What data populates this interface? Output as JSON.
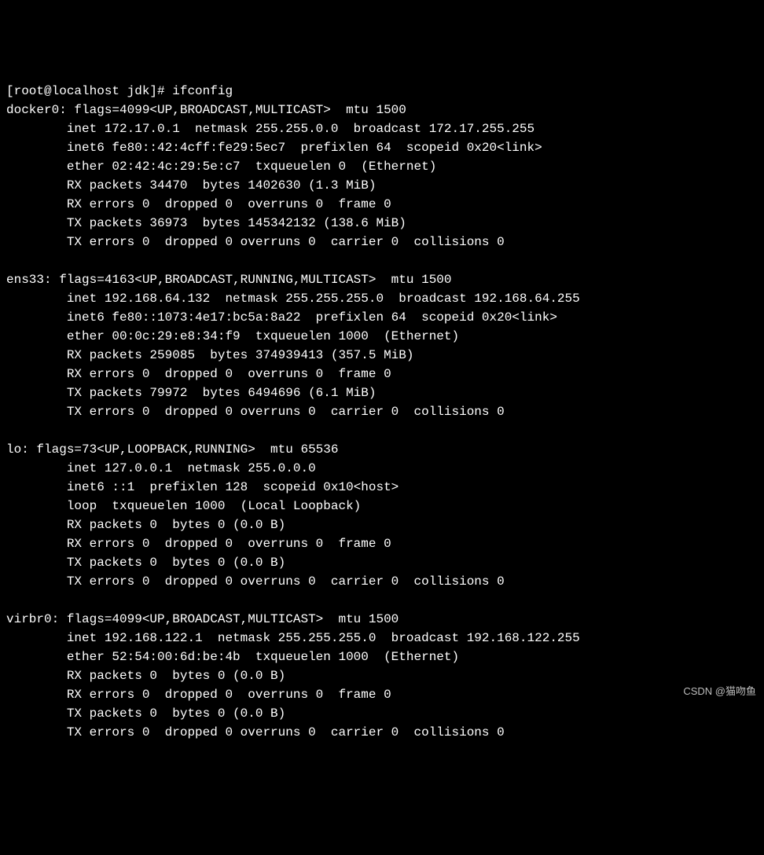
{
  "prompt": "[root@localhost jdk]# ifconfig",
  "interfaces": [
    {
      "name": "docker0",
      "header": "flags=4099<UP,BROADCAST,MULTICAST>  mtu 1500",
      "lines": [
        "inet 172.17.0.1  netmask 255.255.0.0  broadcast 172.17.255.255",
        "inet6 fe80::42:4cff:fe29:5ec7  prefixlen 64  scopeid 0x20<link>",
        "ether 02:42:4c:29:5e:c7  txqueuelen 0  (Ethernet)",
        "RX packets 34470  bytes 1402630 (1.3 MiB)",
        "RX errors 0  dropped 0  overruns 0  frame 0",
        "TX packets 36973  bytes 145342132 (138.6 MiB)",
        "TX errors 0  dropped 0 overruns 0  carrier 0  collisions 0"
      ]
    },
    {
      "name": "ens33",
      "header": "flags=4163<UP,BROADCAST,RUNNING,MULTICAST>  mtu 1500",
      "lines": [
        "inet 192.168.64.132  netmask 255.255.255.0  broadcast 192.168.64.255",
        "inet6 fe80::1073:4e17:bc5a:8a22  prefixlen 64  scopeid 0x20<link>",
        "ether 00:0c:29:e8:34:f9  txqueuelen 1000  (Ethernet)",
        "RX packets 259085  bytes 374939413 (357.5 MiB)",
        "RX errors 0  dropped 0  overruns 0  frame 0",
        "TX packets 79972  bytes 6494696 (6.1 MiB)",
        "TX errors 0  dropped 0 overruns 0  carrier 0  collisions 0"
      ]
    },
    {
      "name": "lo",
      "header": "flags=73<UP,LOOPBACK,RUNNING>  mtu 65536",
      "lines": [
        "inet 127.0.0.1  netmask 255.0.0.0",
        "inet6 ::1  prefixlen 128  scopeid 0x10<host>",
        "loop  txqueuelen 1000  (Local Loopback)",
        "RX packets 0  bytes 0 (0.0 B)",
        "RX errors 0  dropped 0  overruns 0  frame 0",
        "TX packets 0  bytes 0 (0.0 B)",
        "TX errors 0  dropped 0 overruns 0  carrier 0  collisions 0"
      ]
    },
    {
      "name": "virbr0",
      "header": "flags=4099<UP,BROADCAST,MULTICAST>  mtu 1500",
      "lines": [
        "inet 192.168.122.1  netmask 255.255.255.0  broadcast 192.168.122.255",
        "ether 52:54:00:6d:be:4b  txqueuelen 1000  (Ethernet)",
        "RX packets 0  bytes 0 (0.0 B)",
        "RX errors 0  dropped 0  overruns 0  frame 0",
        "TX packets 0  bytes 0 (0.0 B)",
        "TX errors 0  dropped 0 overruns 0  carrier 0  collisions 0"
      ]
    }
  ],
  "watermark": "CSDN @猫吻鱼"
}
